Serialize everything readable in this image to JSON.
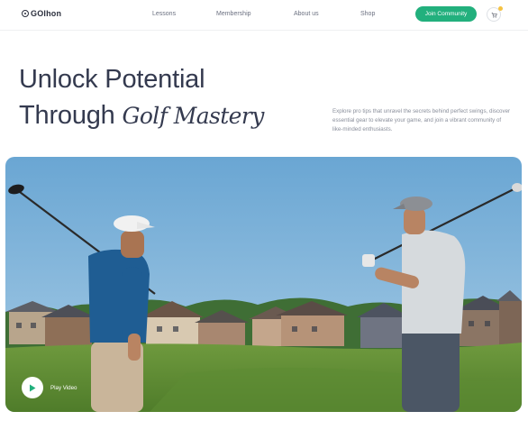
{
  "brand": {
    "name": "GOlhon"
  },
  "nav": {
    "links": [
      "Lessons",
      "Membership",
      "About us",
      "Shop"
    ],
    "cta_label": "Join Community",
    "cart_icon": "cart-icon"
  },
  "hero": {
    "title_line1": "Unlock Potential",
    "title_line2_plain": "Through ",
    "title_line2_italic": "Golf Mastery",
    "description": "Explore pro tips that unravel the secrets behind perfect swings, discover essential gear to elevate your game, and join a vibrant community of like-minded enthusiasts."
  },
  "media": {
    "play_label": "Play Video",
    "play_icon": "play-icon"
  },
  "colors": {
    "accent": "#22b07d",
    "heading": "#343a4f",
    "badge": "#f5c242"
  }
}
